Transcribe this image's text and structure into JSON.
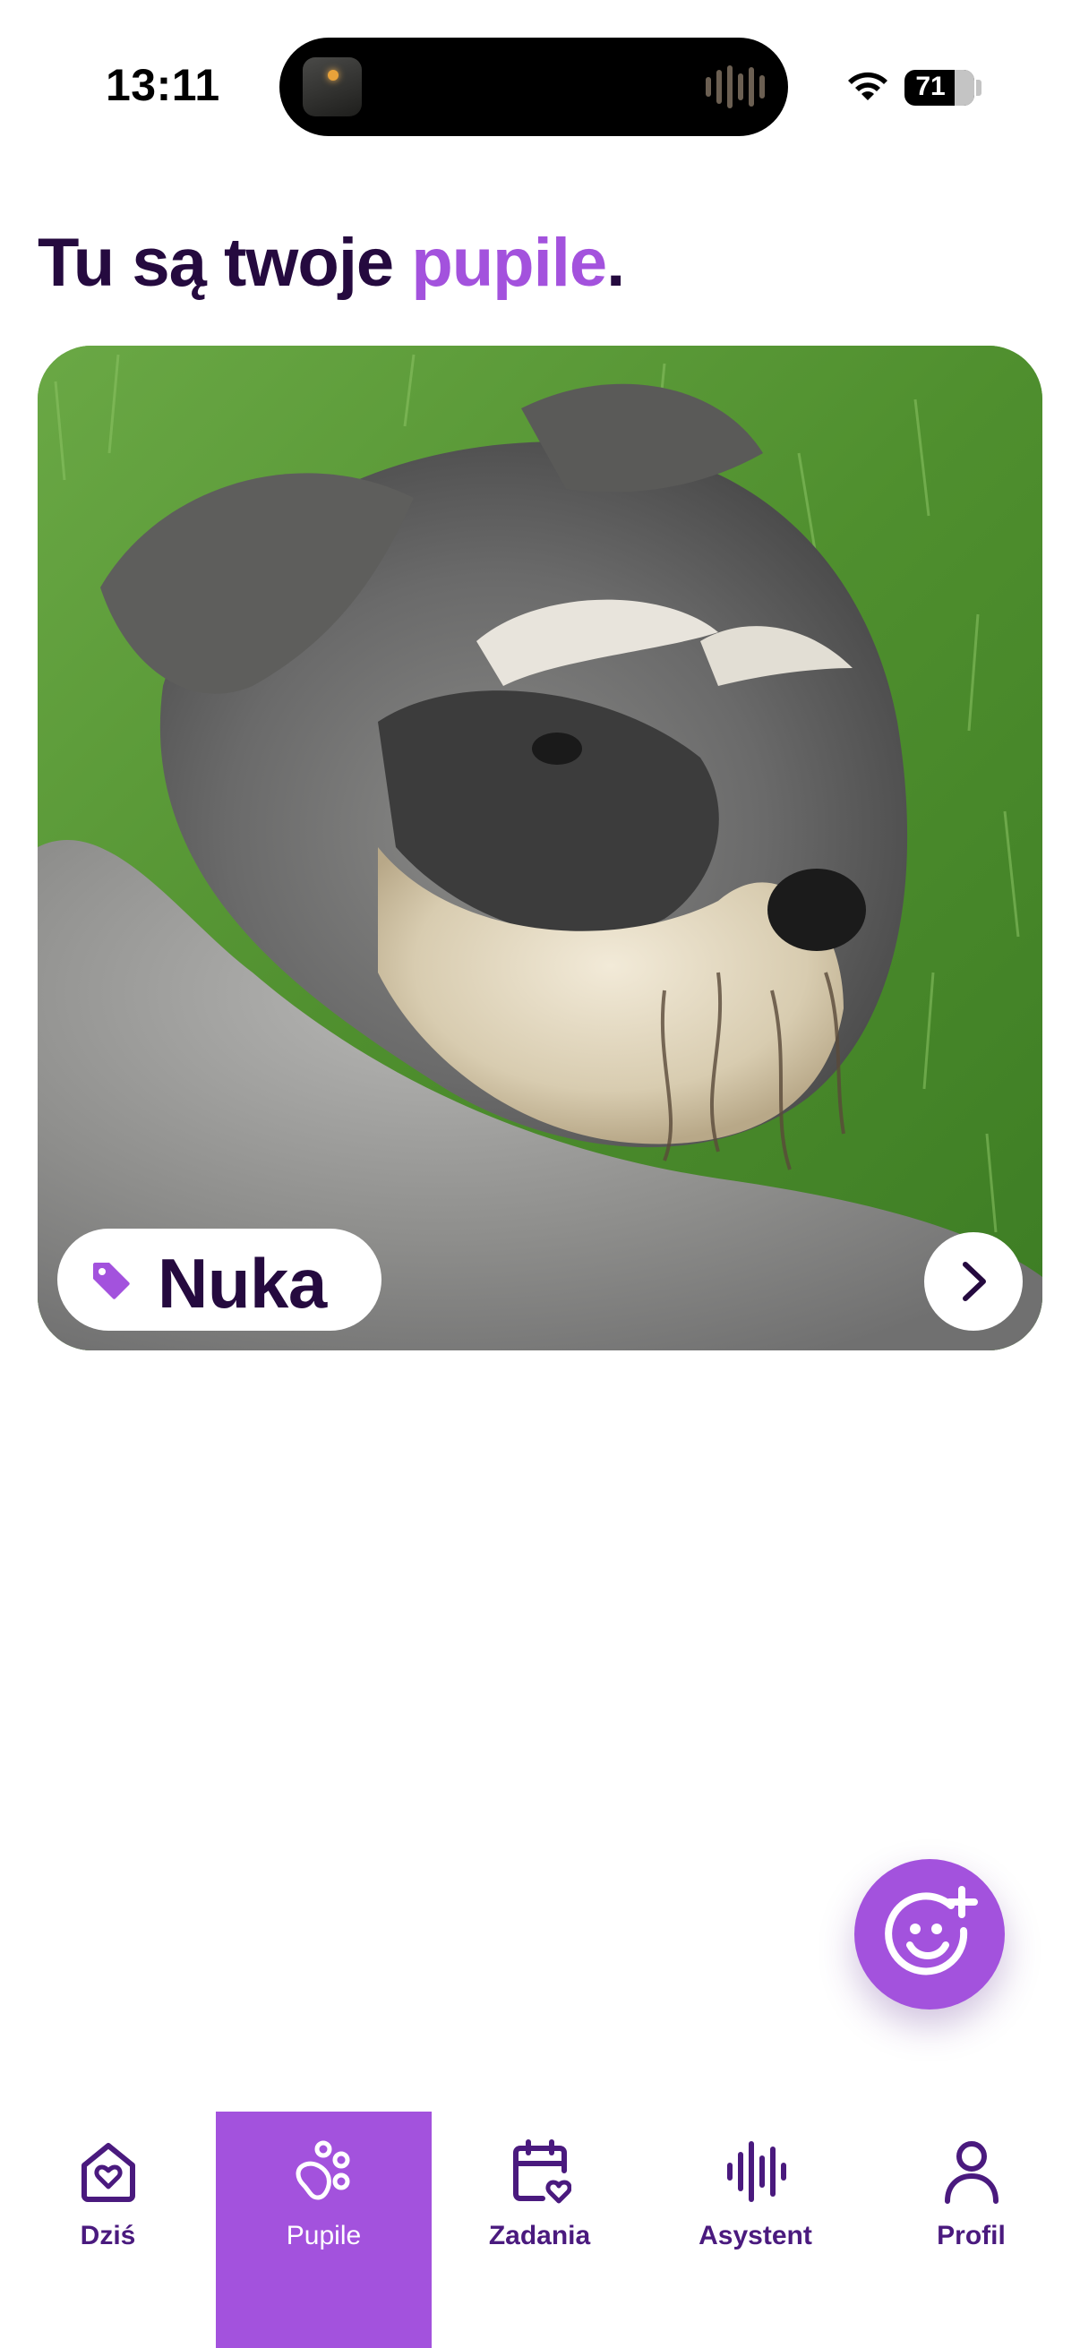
{
  "status_bar": {
    "time": "13:11",
    "battery_level": "71",
    "icons": [
      "dynamic-island-media",
      "wifi-icon",
      "battery-icon"
    ]
  },
  "header": {
    "title_part1": "Tu są twoje ",
    "title_accent": "pupile",
    "title_end": "."
  },
  "pet_card": {
    "name": "Nuka",
    "tag_icon": "tag-icon",
    "open_icon": "chevron-right-icon"
  },
  "fab": {
    "icon": "add-pet-smiley-icon"
  },
  "bottom_nav": {
    "active": "Pupile",
    "items": [
      {
        "label": "Dziś",
        "icon": "home-heart-icon"
      },
      {
        "label": "Pupile",
        "icon": "paw-icon"
      },
      {
        "label": "Zadania",
        "icon": "calendar-heart-icon"
      },
      {
        "label": "Asystent",
        "icon": "voice-wave-icon"
      },
      {
        "label": "Profil",
        "icon": "user-icon"
      }
    ]
  },
  "colors": {
    "accent": "#a352dd",
    "text_dark": "#250a3f",
    "nav_icon": "#4a1a7e",
    "background": "#ffffff"
  }
}
